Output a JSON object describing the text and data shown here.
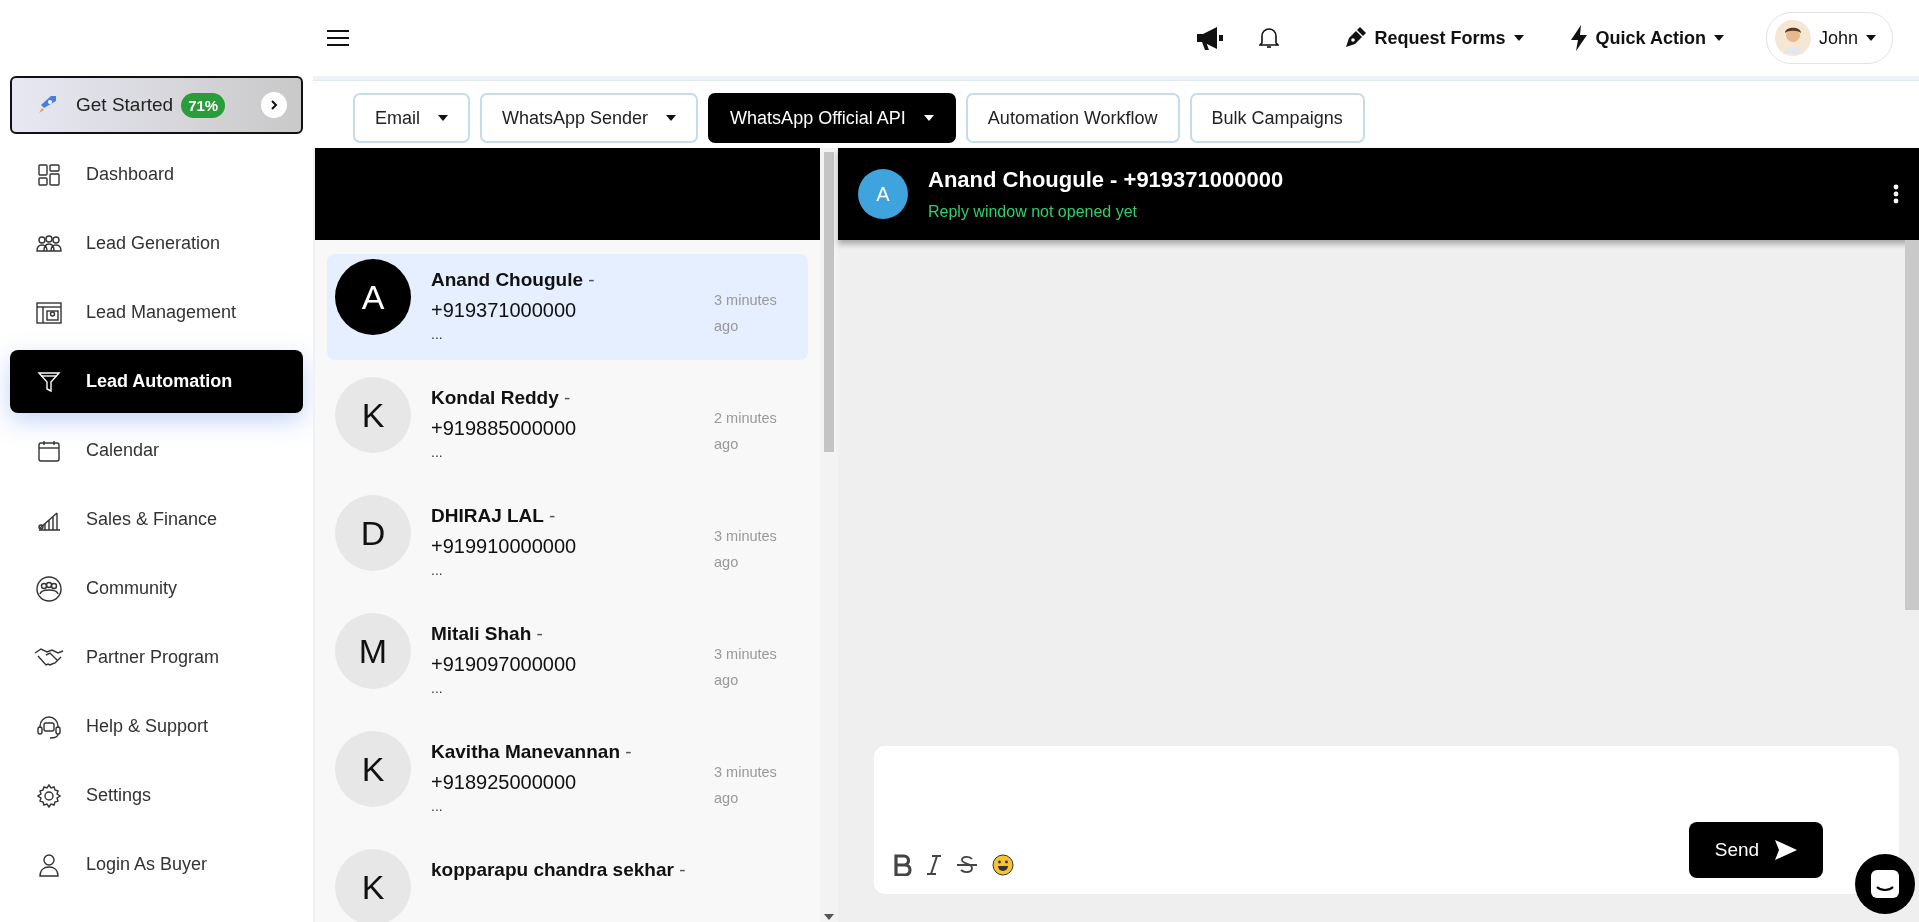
{
  "sidebar": {
    "get_started": {
      "label": "Get Started",
      "badge": "71%"
    },
    "items": [
      {
        "label": "Dashboard",
        "selected": false
      },
      {
        "label": "Lead Generation",
        "selected": false
      },
      {
        "label": "Lead Management",
        "selected": false
      },
      {
        "label": "Lead Automation",
        "selected": true
      },
      {
        "label": "Calendar",
        "selected": false
      },
      {
        "label": "Sales & Finance",
        "selected": false
      },
      {
        "label": "Community",
        "selected": false
      },
      {
        "label": "Partner Program",
        "selected": false
      },
      {
        "label": "Help & Support",
        "selected": false
      },
      {
        "label": "Settings",
        "selected": false
      },
      {
        "label": "Login As Buyer",
        "selected": false
      }
    ]
  },
  "header": {
    "actions": [
      {
        "label": "Request Forms"
      },
      {
        "label": "Quick Action"
      }
    ],
    "user": {
      "name": "John"
    }
  },
  "tabs": [
    {
      "label": "Email",
      "dropdown": true,
      "selected": false
    },
    {
      "label": "WhatsApp Sender",
      "dropdown": true,
      "selected": false
    },
    {
      "label": "WhatsApp Official API",
      "dropdown": true,
      "selected": true
    },
    {
      "label": "Automation Workflow",
      "dropdown": false,
      "selected": false
    },
    {
      "label": "Bulk Campaigns",
      "dropdown": false,
      "selected": false
    }
  ],
  "chat_list": {
    "contacts": [
      {
        "initial": "A",
        "name": "Anand Chougule",
        "separator": "-",
        "phone": "+919371000000",
        "preview": "...",
        "time": "3 minutes ago",
        "selected": true
      },
      {
        "initial": "K",
        "name": "Kondal Reddy",
        "separator": "-",
        "phone": "+919885000000",
        "preview": "...",
        "time": "2 minutes ago",
        "selected": false
      },
      {
        "initial": "D",
        "name": "DHIRAJ LAL",
        "separator": "-",
        "phone": "+919910000000",
        "preview": "...",
        "time": "3 minutes ago",
        "selected": false
      },
      {
        "initial": "M",
        "name": "Mitali Shah",
        "separator": "-",
        "phone": "+919097000000",
        "preview": "...",
        "time": "3 minutes ago",
        "selected": false
      },
      {
        "initial": "K",
        "name": "Kavitha Manevannan",
        "separator": "-",
        "phone": "+918925000000",
        "preview": "...",
        "time": "3 minutes ago",
        "selected": false
      },
      {
        "initial": "K",
        "name": "kopparapu chandra sekhar",
        "separator": "-",
        "selected": false
      }
    ]
  },
  "chat": {
    "contact": {
      "initial": "A",
      "title": "Anand Chougule - +919371000000",
      "status": "Reply window not opened yet"
    },
    "composer": {
      "send": "Send"
    }
  }
}
